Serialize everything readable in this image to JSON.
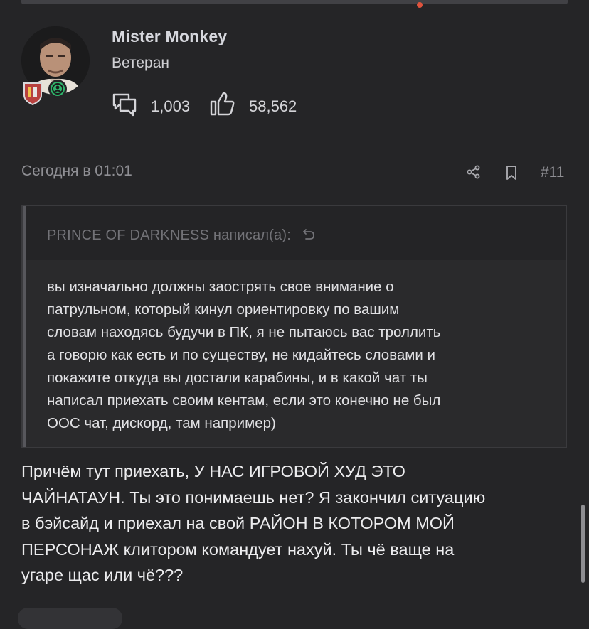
{
  "user": {
    "name": "Mister Monkey",
    "rank": "Ветеран",
    "messages_count": "1,003",
    "reactions_count": "58,562"
  },
  "post": {
    "date": "Сегодня в 01:01",
    "number": "#11"
  },
  "quote": {
    "author_line": "PRINCE OF DARKNESS написал(а):",
    "text": "вы изначально должны заострять свое внимание о\nпатрульном, который кинул ориентировку по вашим\nсловам находясь будучи в ПК, я не пытаюсь вас троллить\nа говорю как есть и по существу, не кидайтесь словами и\nпокажите откуда вы достали карабины, и в какой чат ты\nнаписал приехать своим кентам, если это конечно не был\nООС чат, дискорд, там например)"
  },
  "reply": {
    "text": "Причём тут приехать, У НАС ИГРОВОЙ ХУД ЭТО\nЧАЙНАТАУН. Ты это понимаешь нет? Я закончил ситуацию\nв бэйсайд и приехал на свой РАЙОН В КОТОРОМ МОЙ\nПЕРСОНАЖ клитором командует нахуй. Ты чё ваще на\nугаре щас или чё???"
  },
  "icons": {
    "messages": "speech-bubbles-icon",
    "reactions": "thumbs-up-icon",
    "share": "share-icon",
    "bookmark": "bookmark-icon",
    "quote_jump": "reply-arrow-icon",
    "online": "online-status-icon",
    "badge": "shield-badge-icon"
  },
  "colors": {
    "background": "#252527",
    "online_green": "#2fb36a",
    "notification_dot": "#e0533d"
  }
}
